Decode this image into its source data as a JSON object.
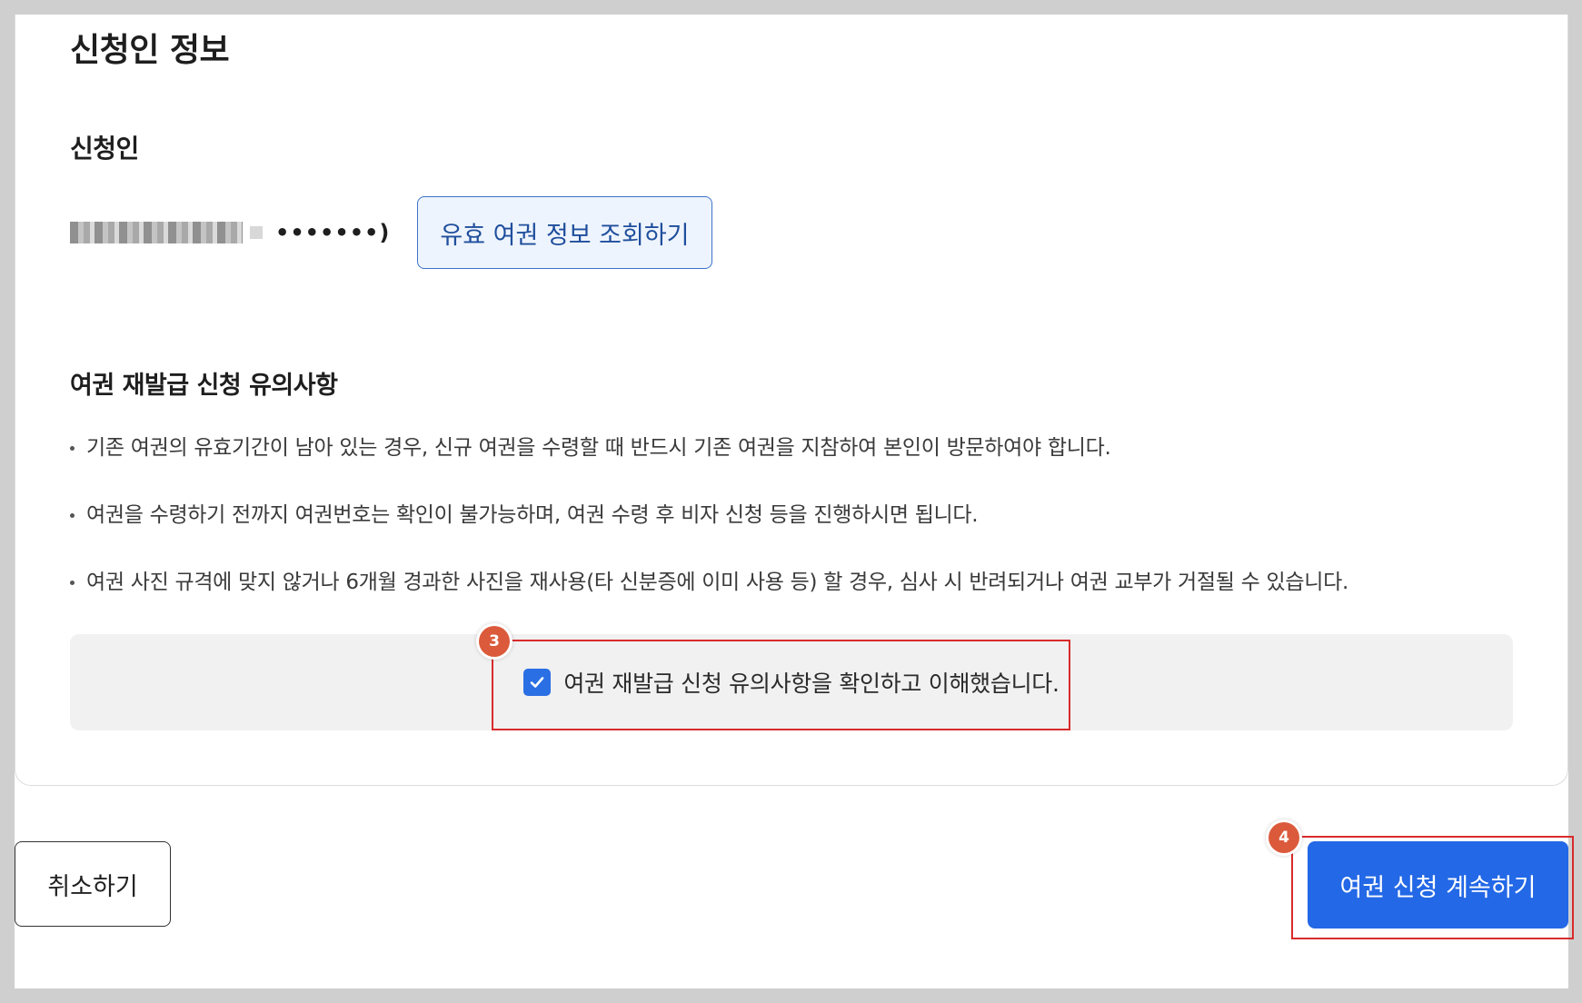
{
  "applicant_info": {
    "section_title": "신청인 정보",
    "applicant_label": "신청인",
    "applicant_id_masked": "•••••••)",
    "lookup_button": "유효 여권 정보 조회하기"
  },
  "notice": {
    "title": "여권 재발급 신청 유의사항",
    "items": [
      "기존 여권의 유효기간이 남아 있는 경우, 신규 여권을 수령할 때 반드시 기존 여권을 지참하여 본인이 방문하여야 합니다.",
      "여권을 수령하기 전까지 여권번호는 확인이 불가능하며, 여권 수령 후 비자 신청 등을 진행하시면 됩니다.",
      "여권 사진 규격에 맞지 않거나 6개월 경과한 사진을 재사용(타 신분증에 이미 사용 등) 할 경우, 심사 시 반려되거나 여권 교부가 거절될 수 있습니다."
    ]
  },
  "agreement": {
    "checked": true,
    "label": "여권 재발급 신청 유의사항을 확인하고 이해했습니다."
  },
  "actions": {
    "cancel_label": "취소하기",
    "continue_label": "여권 신청 계속하기"
  },
  "annotations": {
    "step_agree": "3",
    "step_continue": "4",
    "highlight_color": "#d92b2b",
    "badge_color": "#dc5a3c"
  },
  "colors": {
    "primary": "#2368e6",
    "checkbox": "#2b6fe4"
  }
}
